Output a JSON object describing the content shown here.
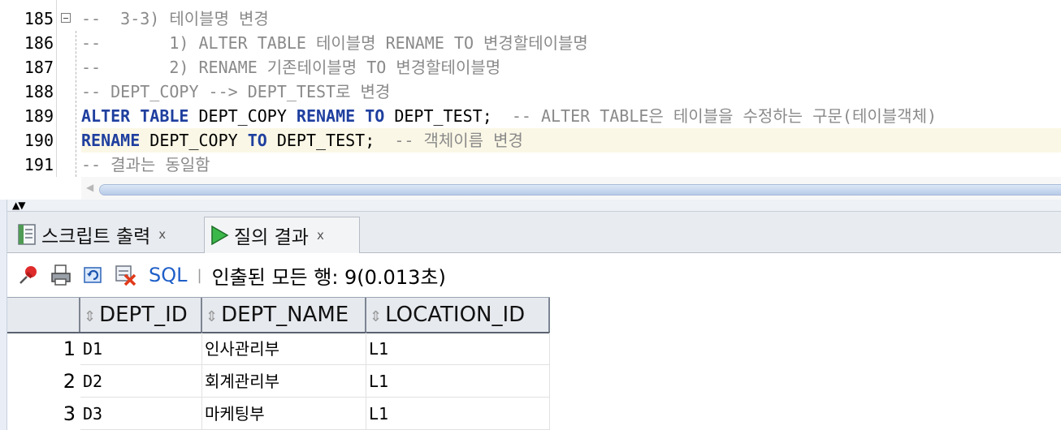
{
  "editor": {
    "lines": [
      {
        "num": "185",
        "segments": [
          {
            "t": "--  3-3) 테이블명 변경",
            "c": "cmt"
          }
        ]
      },
      {
        "num": "186",
        "segments": [
          {
            "t": "--       1) ALTER TABLE 테이블명 RENAME TO 변경할테이블명",
            "c": "cmt"
          }
        ]
      },
      {
        "num": "187",
        "segments": [
          {
            "t": "--       2) RENAME 기존테이블명 TO 변경할테이블명",
            "c": "cmt"
          }
        ]
      },
      {
        "num": "188",
        "segments": [
          {
            "t": "-- DEPT_COPY --> DEPT_TEST로 변경",
            "c": "cmt"
          }
        ]
      },
      {
        "num": "189",
        "segments": [
          {
            "t": "ALTER TABLE",
            "c": "kw"
          },
          {
            "t": " DEPT_COPY ",
            "c": ""
          },
          {
            "t": "RENAME TO",
            "c": "kw"
          },
          {
            "t": " DEPT_TEST;  ",
            "c": ""
          },
          {
            "t": "-- ALTER TABLE은 테이블을 수정하는 구문(테이블객체)",
            "c": "cmt"
          }
        ]
      },
      {
        "num": "190",
        "segments": [
          {
            "t": "RENAME",
            "c": "kw"
          },
          {
            "t": " DEPT_COPY ",
            "c": ""
          },
          {
            "t": "TO",
            "c": "kw"
          },
          {
            "t": " DEPT_TEST;  ",
            "c": ""
          },
          {
            "t": "-- 객체이름 변경",
            "c": "cmt"
          }
        ]
      },
      {
        "num": "191",
        "segments": [
          {
            "t": "-- 결과는 동일함",
            "c": "cmt"
          }
        ]
      }
    ]
  },
  "tabs": [
    {
      "label": "스크립트 출력",
      "icon": "script-output-icon",
      "close": "x"
    },
    {
      "label": "질의 결과",
      "icon": "run-query-icon",
      "close": "x"
    }
  ],
  "toolbar": {
    "sql_label": "SQL",
    "separator": "|",
    "fetch_status": "인출된 모든 행: 9(0.013초)"
  },
  "grid": {
    "columns": [
      "DEPT_ID",
      "DEPT_NAME",
      "LOCATION_ID"
    ],
    "rows": [
      {
        "n": "1",
        "cells": [
          "D1",
          "인사관리부",
          "L1"
        ]
      },
      {
        "n": "2",
        "cells": [
          "D2",
          "회계관리부",
          "L1"
        ]
      },
      {
        "n": "3",
        "cells": [
          "D3",
          "마케팅부",
          "L1"
        ]
      }
    ]
  },
  "colors": {
    "keyword": "#1f3f9f",
    "comment": "#8a8a8a",
    "current_line": "#fbf7e6",
    "link": "#1f5fc8"
  }
}
